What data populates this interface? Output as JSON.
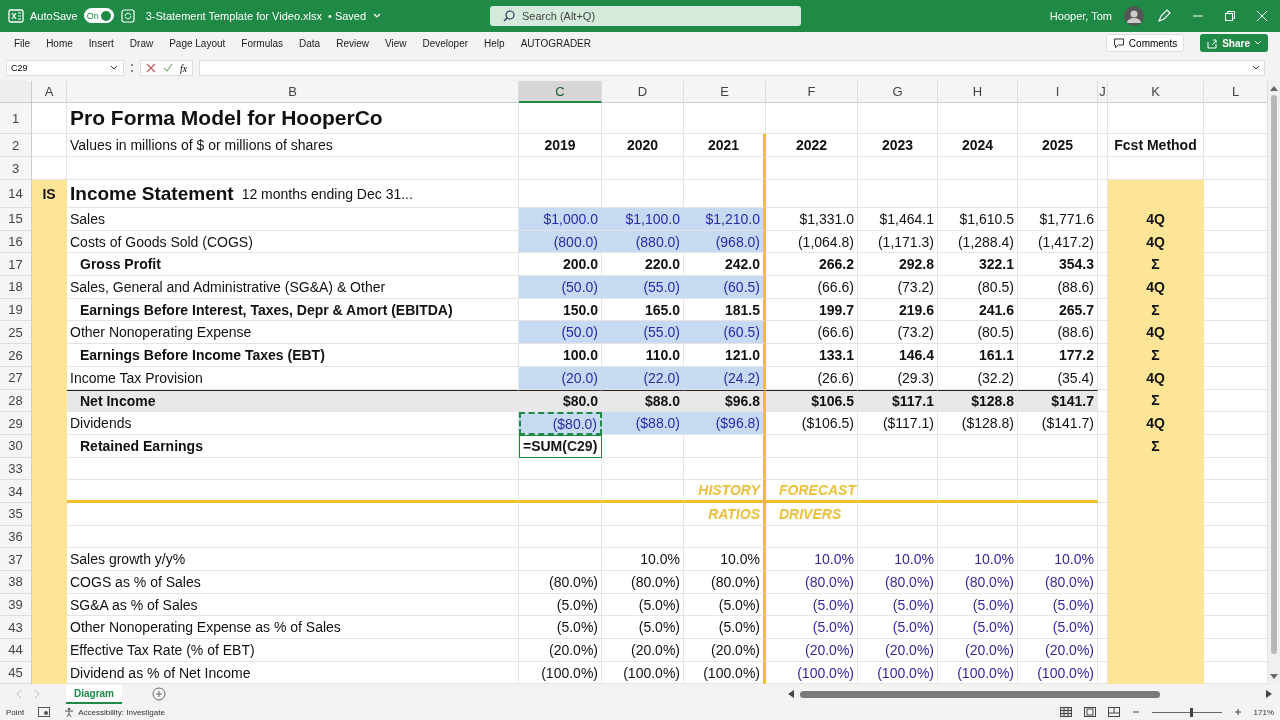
{
  "title_bar": {
    "autosave_label": "AutoSave",
    "autosave_on": true,
    "toggle_label": "On",
    "file_name": "3-Statement Template for Video.xlsx",
    "save_status": "• Saved",
    "search_placeholder": "Search (Alt+Q)",
    "user_name": "Hooper, Tom"
  },
  "ribbon_tabs": [
    {
      "label": "File",
      "selected": false
    },
    {
      "label": "Home",
      "selected": false
    },
    {
      "label": "Insert",
      "selected": false
    },
    {
      "label": "Draw",
      "selected": false
    },
    {
      "label": "Page Layout",
      "selected": false
    },
    {
      "label": "Formulas",
      "selected": false
    },
    {
      "label": "Data",
      "selected": false
    },
    {
      "label": "Review",
      "selected": false
    },
    {
      "label": "View",
      "selected": false
    },
    {
      "label": "Developer",
      "selected": false
    },
    {
      "label": "Help",
      "selected": false
    },
    {
      "label": "AUTOGRADER",
      "selected": false
    }
  ],
  "comments_button": "Comments",
  "share_button": "Share",
  "formula_bar": {
    "name_box": "C29",
    "fx_label": "fx"
  },
  "sheet": {
    "columns": [
      {
        "label": "A",
        "selected": false
      },
      {
        "label": "B",
        "selected": false
      },
      {
        "label": "C",
        "selected": true
      },
      {
        "label": "D",
        "selected": false
      },
      {
        "label": "E",
        "selected": false
      },
      {
        "label": "F",
        "selected": false
      },
      {
        "label": "G",
        "selected": false
      },
      {
        "label": "H",
        "selected": false
      },
      {
        "label": "I",
        "selected": false
      },
      {
        "label": "J",
        "selected": false
      },
      {
        "label": "K",
        "selected": false
      },
      {
        "label": "L",
        "selected": false
      }
    ],
    "rows": [
      {
        "number": "1",
        "kind": "title",
        "cells": [
          null,
          "Pro Forma Model for HooperCo"
        ]
      },
      {
        "number": "2",
        "kind": "header",
        "cells": [
          null,
          "Values in millions of $ or millions of shares",
          "2019",
          "2020",
          "2021",
          "2022",
          "2023",
          "2024",
          "2025",
          null,
          "Fcst Method"
        ]
      },
      {
        "number": "3",
        "kind": "spacer",
        "cells": []
      },
      {
        "number": "14",
        "kind": "section",
        "cells": [
          "IS",
          "Income Statement"
        ],
        "note": "12 months ending Dec 31..."
      },
      {
        "number": "15",
        "kind": "input",
        "cells": [
          null,
          "Sales",
          "$1,000.0",
          "$1,100.0",
          "$1,210.0",
          "$1,331.0",
          "$1,464.1",
          "$1,610.5",
          "$1,771.6",
          null,
          "4Q"
        ]
      },
      {
        "number": "16",
        "kind": "input",
        "cells": [
          null,
          "Costs of Goods Sold (COGS)",
          "(800.0)",
          "(880.0)",
          "(968.0)",
          "(1,064.8)",
          "(1,171.3)",
          "(1,288.4)",
          "(1,417.2)",
          null,
          "4Q"
        ]
      },
      {
        "number": "17",
        "kind": "subtotal",
        "cells": [
          null,
          "Gross Profit",
          "200.0",
          "220.0",
          "242.0",
          "266.2",
          "292.8",
          "322.1",
          "354.3",
          null,
          "Σ"
        ]
      },
      {
        "number": "18",
        "kind": "input",
        "cells": [
          null,
          "Sales, General and Administrative (SG&A) & Other",
          "(50.0)",
          "(55.0)",
          "(60.5)",
          "(66.6)",
          "(73.2)",
          "(80.5)",
          "(88.6)",
          null,
          "4Q"
        ]
      },
      {
        "number": "19",
        "kind": "subtotal",
        "cells": [
          null,
          "Earnings Before Interest, Taxes, Depr & Amort (EBITDA)",
          "150.0",
          "165.0",
          "181.5",
          "199.7",
          "219.6",
          "241.6",
          "265.7",
          null,
          "Σ"
        ]
      },
      {
        "number": "25",
        "kind": "input",
        "cells": [
          null,
          "Other Nonoperating Expense",
          "(50.0)",
          "(55.0)",
          "(60.5)",
          "(66.6)",
          "(73.2)",
          "(80.5)",
          "(88.6)",
          null,
          "4Q"
        ]
      },
      {
        "number": "26",
        "kind": "subtotal",
        "cells": [
          null,
          "Earnings Before Income Taxes (EBT)",
          "100.0",
          "110.0",
          "121.0",
          "133.1",
          "146.4",
          "161.1",
          "177.2",
          null,
          "Σ"
        ]
      },
      {
        "number": "27",
        "kind": "input",
        "cells": [
          null,
          "Income Tax Provision",
          "(20.0)",
          "(22.0)",
          "(24.2)",
          "(26.6)",
          "(29.3)",
          "(32.2)",
          "(35.4)",
          null,
          "4Q"
        ]
      },
      {
        "number": "28",
        "kind": "net",
        "cells": [
          null,
          "Net Income",
          "$80.0",
          "$88.0",
          "$96.8",
          "$106.5",
          "$117.1",
          "$128.8",
          "$141.7",
          null,
          "Σ"
        ]
      },
      {
        "number": "29",
        "kind": "input",
        "cells": [
          null,
          "Dividends",
          {
            "text": "($80.0)",
            "marquee": true
          },
          "($88.0)",
          "($96.8)",
          "($106.5)",
          "($117.1)",
          "($128.8)",
          "($141.7)",
          null,
          "4Q"
        ]
      },
      {
        "number": "30",
        "kind": "subtotal",
        "cells": [
          null,
          "Retained Earnings",
          {
            "text": "=SUM(**C29**)",
            "editing": true
          },
          null,
          null,
          null,
          null,
          null,
          null,
          null,
          "Σ"
        ]
      },
      {
        "number": "33",
        "kind": "blank",
        "cells": []
      },
      {
        "number": "34",
        "kind": "marker",
        "gold_rule_below": true,
        "cells": [
          null,
          null,
          null,
          null,
          "HISTORY",
          "FORECAST"
        ]
      },
      {
        "number": "35",
        "kind": "marker",
        "cells": [
          null,
          null,
          null,
          null,
          "RATIOS",
          "DRIVERS"
        ]
      },
      {
        "number": "36",
        "kind": "blank",
        "cells": []
      },
      {
        "number": "37",
        "kind": "ratio",
        "cells": [
          null,
          "Sales growth y/y%",
          null,
          "10.0%",
          "10.0%",
          "10.0%",
          "10.0%",
          "10.0%",
          "10.0%"
        ]
      },
      {
        "number": "38",
        "kind": "ratio",
        "cells": [
          null,
          "COGS as % of Sales",
          "(80.0%)",
          "(80.0%)",
          "(80.0%)",
          "(80.0%)",
          "(80.0%)",
          "(80.0%)",
          "(80.0%)"
        ]
      },
      {
        "number": "39",
        "kind": "ratio",
        "cells": [
          null,
          "SG&A as % of Sales",
          "(5.0%)",
          "(5.0%)",
          "(5.0%)",
          "(5.0%)",
          "(5.0%)",
          "(5.0%)",
          "(5.0%)"
        ]
      },
      {
        "number": "43",
        "kind": "ratio",
        "cells": [
          null,
          "Other Nonoperating Expense as % of Sales",
          "(5.0%)",
          "(5.0%)",
          "(5.0%)",
          "(5.0%)",
          "(5.0%)",
          "(5.0%)",
          "(5.0%)"
        ]
      },
      {
        "number": "44",
        "kind": "ratio",
        "cells": [
          null,
          "Effective Tax Rate (% of EBT)",
          "(20.0%)",
          "(20.0%)",
          "(20.0%)",
          "(20.0%)",
          "(20.0%)",
          "(20.0%)",
          "(20.0%)"
        ]
      },
      {
        "number": "45",
        "kind": "ratio",
        "cells": [
          null,
          "Dividend as % of Net Income",
          "(100.0%)",
          "(100.0%)",
          "(100.0%)",
          "(100.0%)",
          "(100.0%)",
          "(100.0%)",
          "(100.0%)"
        ]
      }
    ]
  },
  "sheet_tabs": [
    {
      "label": "Diagram",
      "selected": true
    }
  ],
  "status_bar": {
    "mode": "Point",
    "accessibility": "Accessibility: Investigate",
    "zoom": "171%",
    "zoom_slider": {
      "level": 0.57
    }
  }
}
